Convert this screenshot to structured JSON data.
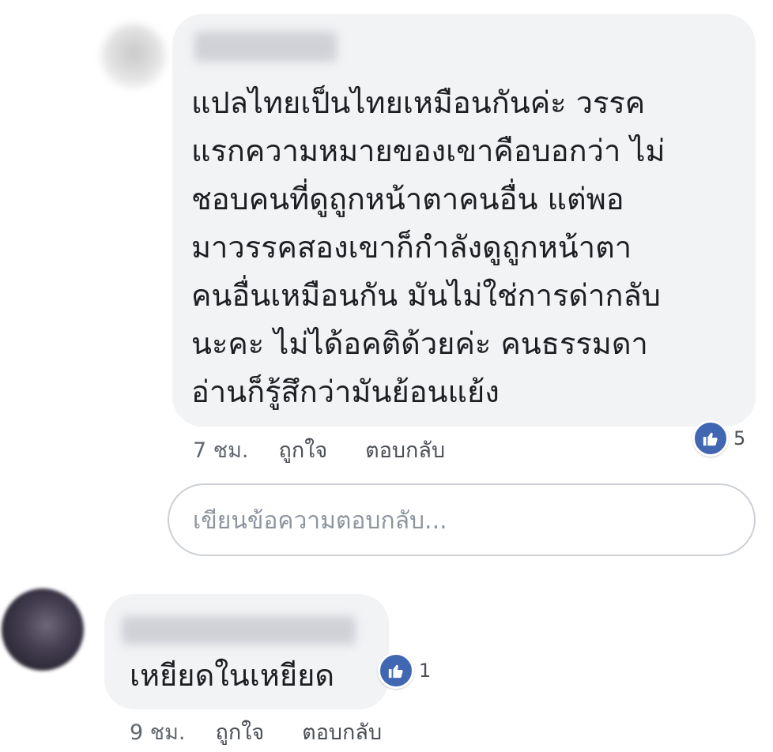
{
  "comments": [
    {
      "text": "แปลไทยเป็นไทยเหมือนกันค่ะ วรรค\nแรกความหมายของเขาคือบอกว่า ไม่\nชอบคนที่ดูถูกหน้าตาคนอื่น แต่พอ\nมาวรรคสองเขาก็กำลังดูถูกหน้าตา\nคนอื่นเหมือนกัน มันไม่ใช่การด่ากลับ\nนะคะ ไม่ได้อคติด้วยค่ะ คนธรรมดา\nอ่านก็รู้สึกว่ามันย้อนแย้ง",
      "time": "7 ชม.",
      "like_label": "ถูกใจ",
      "reply_label": "ตอบกลับ",
      "reaction_count": "5",
      "reaction_icon": "like-icon"
    },
    {
      "text": "เหยียดในเหยียด",
      "time": "9 ชม.",
      "like_label": "ถูกใจ",
      "reply_label": "ตอบกลับ",
      "reaction_count": "1",
      "reaction_icon": "like-icon"
    }
  ],
  "reply_box": {
    "placeholder": "เขียนข้อความตอบกลับ..."
  },
  "colors": {
    "bubble": "#f2f3f5",
    "like_badge": "#4267b2",
    "meta_text": "#616770"
  }
}
